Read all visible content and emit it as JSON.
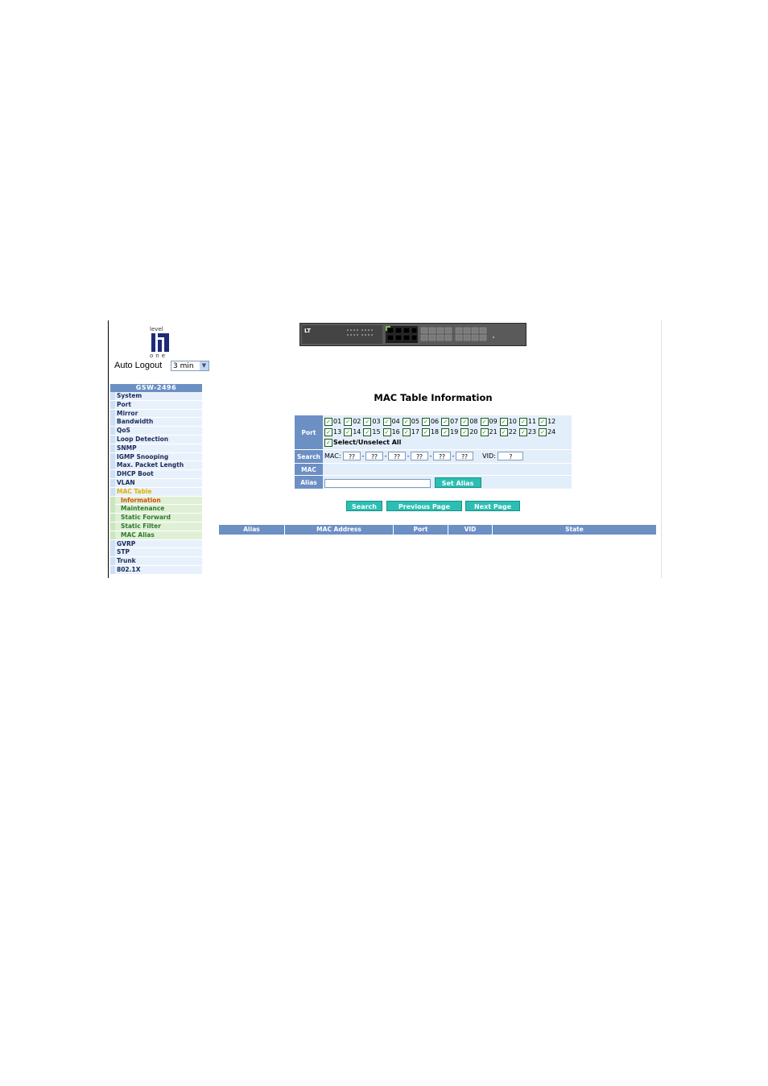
{
  "logo": {
    "top_text": "level",
    "bottom_text": "one"
  },
  "auto_logout": {
    "label": "Auto Logout",
    "value": "3 min"
  },
  "sidebar": {
    "model": "GSW-2496",
    "items": [
      {
        "label": "System"
      },
      {
        "label": "Port"
      },
      {
        "label": "Mirror"
      },
      {
        "label": "Bandwidth"
      },
      {
        "label": "QoS"
      },
      {
        "label": "Loop Detection"
      },
      {
        "label": "SNMP"
      },
      {
        "label": "IGMP Snooping"
      },
      {
        "label": "Max. Packet Length"
      },
      {
        "label": "DHCP Boot"
      },
      {
        "label": "VLAN"
      },
      {
        "label": "MAC Table"
      },
      {
        "label": "Information"
      },
      {
        "label": "Maintenance"
      },
      {
        "label": "Static Forward"
      },
      {
        "label": "Static Filter"
      },
      {
        "label": "MAC Alias"
      },
      {
        "label": "GVRP"
      },
      {
        "label": "STP"
      },
      {
        "label": "Trunk"
      },
      {
        "label": "802.1X"
      }
    ]
  },
  "page_title": "MAC Table Information",
  "form": {
    "port_label": "Port",
    "ports": [
      "01",
      "02",
      "03",
      "04",
      "05",
      "06",
      "07",
      "08",
      "09",
      "10",
      "11",
      "12",
      "13",
      "14",
      "15",
      "16",
      "17",
      "18",
      "19",
      "20",
      "21",
      "22",
      "23",
      "24"
    ],
    "select_all": "Select/Unselect All",
    "search_label": "Search",
    "mac_label": "MAC:",
    "mac_octets": [
      "??",
      "??",
      "??",
      "??",
      "??",
      "??"
    ],
    "vid_label": "VID:",
    "vid_value": "?",
    "mac_row_label": "MAC",
    "alias_label": "Alias",
    "alias_value": "",
    "set_alias": "Set Alias"
  },
  "buttons": {
    "search": "Search",
    "previous": "Previous Page",
    "next": "Next Page"
  },
  "table": {
    "columns": [
      "Alias",
      "MAC Address",
      "Port",
      "VID",
      "State"
    ]
  },
  "colors": {
    "header_blue": "#6c8fc4",
    "button_teal": "#2bbfb3",
    "row_bg": "#e3eefb",
    "active_menu": "#e0b000",
    "current_sub": "#d05000"
  }
}
